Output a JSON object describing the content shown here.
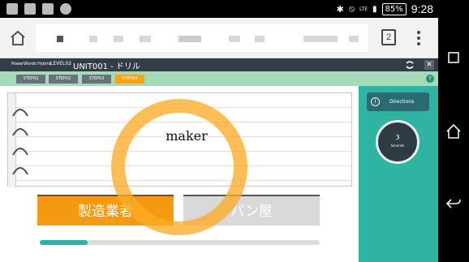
{
  "status_bar": {
    "battery": "85%",
    "time": "9:28",
    "network": "LTE"
  },
  "browser": {
    "tab_count": "2"
  },
  "app": {
    "brand": "PowerWords Hybrid",
    "level": "LEVEL02",
    "title": "UNIT001 - ドリル",
    "close": "✕"
  },
  "steps": {
    "items": [
      {
        "label": "STEP01"
      },
      {
        "label": "STEP02"
      },
      {
        "label": "STEP03"
      },
      {
        "label": "STEP04"
      }
    ],
    "help": "?"
  },
  "quiz": {
    "word": "maker",
    "answers": [
      {
        "label": "製造業者"
      },
      {
        "label": "パン屋"
      }
    ],
    "progress": 0.17
  },
  "sidebar": {
    "directions_label": "Directions",
    "info_icon": "i",
    "timer_value": "3",
    "timer_unit": "Seconds"
  },
  "colors": {
    "accent_orange": "#f59a10",
    "teal": "#2fb3a3",
    "header": "#343d47"
  }
}
